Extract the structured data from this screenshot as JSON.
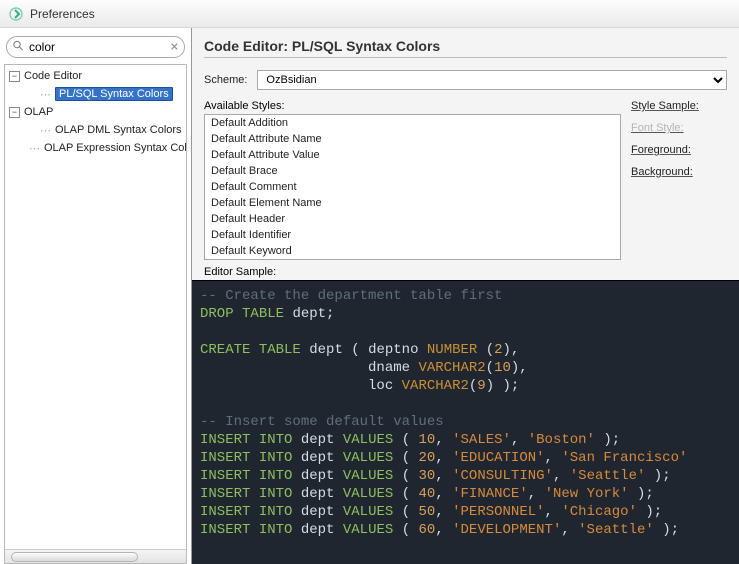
{
  "window": {
    "title": "Preferences"
  },
  "search": {
    "value": "color",
    "placeholder": ""
  },
  "tree": {
    "nodes": [
      {
        "label": "Code Editor",
        "expander": "−",
        "level": 0
      },
      {
        "label": "PL/SQL Syntax Colors",
        "level": 1,
        "selected": true
      },
      {
        "label": "OLAP",
        "expander": "−",
        "level": 0
      },
      {
        "label": "OLAP DML Syntax Colors",
        "level": 1
      },
      {
        "label": "OLAP Expression Syntax Colors",
        "level": 1
      }
    ]
  },
  "header": {
    "title": "Code Editor: PL/SQL Syntax Colors"
  },
  "scheme": {
    "label": "Scheme:",
    "value": "OzBsidian"
  },
  "styles": {
    "label": "Available Styles:",
    "items": [
      "Default Addition",
      "Default Attribute Name",
      "Default Attribute Value",
      "Default Brace",
      "Default Comment",
      "Default Element Name",
      "Default Header",
      "Default Identifier",
      "Default Keyword"
    ]
  },
  "props": {
    "sample": "Style Sample:",
    "font": "Font Style:",
    "fg": "Foreground:",
    "bg": "Background:"
  },
  "editor_label": "Editor Sample:",
  "code": {
    "c1": "-- Create the department table first",
    "drop": "DROP",
    "table": "TABLE",
    "dept": "dept",
    "semi": ";",
    "create": "CREATE",
    "lp": "(",
    "rp": ")",
    "comma": ",",
    "deptno": "deptno",
    "number": "NUMBER",
    "two": "2",
    "dname": "dname",
    "varchar2": "VARCHAR2",
    "ten": "10",
    "loc": "loc",
    "nine": "9",
    "c2": "-- Insert some default values",
    "insert": "INSERT",
    "into": "INTO",
    "values": "VALUES",
    "n10": "10",
    "n20": "20",
    "n30": "30",
    "n40": "40",
    "n50": "50",
    "n60": "60",
    "s_sales": "'SALES'",
    "s_boston": "'Boston'",
    "s_edu": "'EDUCATION'",
    "s_sf": "'San Francisco'",
    "s_cons": "'CONSULTING'",
    "s_sea": "'Seattle'",
    "s_fin": "'FINANCE'",
    "s_ny": "'New York'",
    "s_pers": "'PERSONNEL'",
    "s_chi": "'Chicago'",
    "s_dev": "'DEVELOPMENT'"
  }
}
